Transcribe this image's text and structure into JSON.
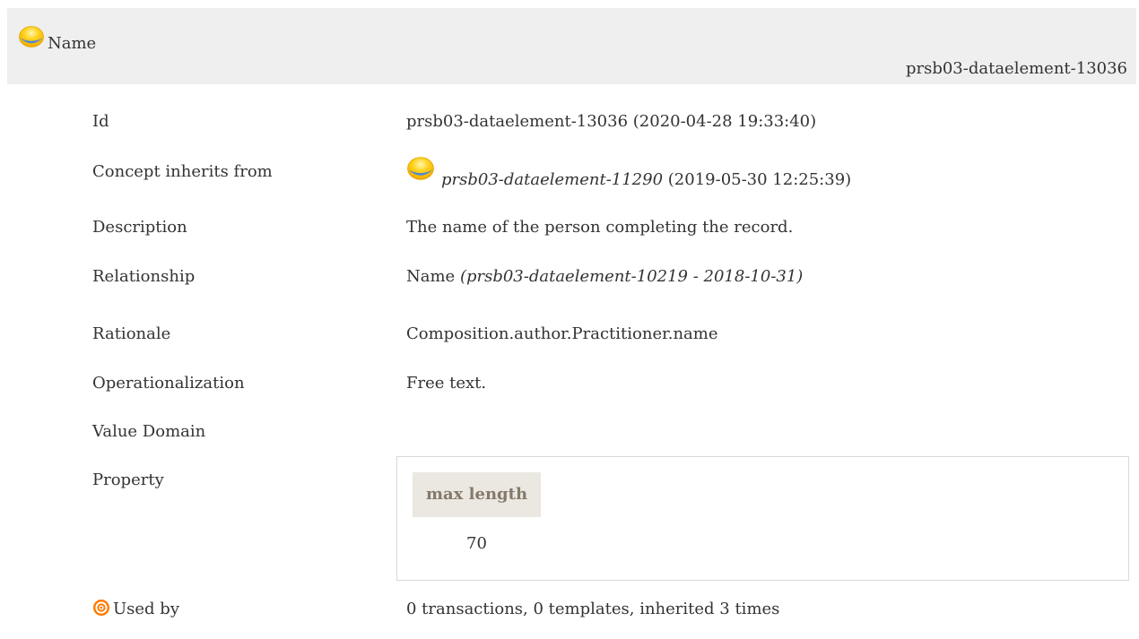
{
  "header": {
    "title": "Name",
    "identifier": "prsb03-dataelement-13036"
  },
  "rows": {
    "id": {
      "label": "Id",
      "value": "prsb03-dataelement-13036 (2020-04-28 19:33:40)"
    },
    "inherits": {
      "label": "Concept inherits from",
      "link": "prsb03-dataelement-11290",
      "timestamp": "(2019-05-30 12:25:39)"
    },
    "description": {
      "label": "Description",
      "value": "The name of the person completing the record."
    },
    "relationship": {
      "label": "Relationship",
      "value": "Name",
      "ref": "(prsb03-dataelement-10219 - 2018-10-31)"
    },
    "rationale": {
      "label": "Rationale",
      "value": "Composition.author.Practitioner.name"
    },
    "operationalization": {
      "label": "Operationalization",
      "value": "Free text."
    },
    "value_domain": {
      "label": "Value Domain"
    },
    "property": {
      "label": "Property",
      "column_header": "max length",
      "column_value": "70"
    },
    "used_by": {
      "label": "Used by",
      "value": "0 transactions, 0 templates, inherited 3 times"
    }
  },
  "icons": {
    "status": "yellow-orb-icon",
    "used_by": "target-icon"
  },
  "colors": {
    "header_bg": "#efefef",
    "orb": "#f7c100",
    "property_header_bg": "#ebe7e1",
    "property_header_text": "#85796b",
    "target": "#ff7a00"
  }
}
